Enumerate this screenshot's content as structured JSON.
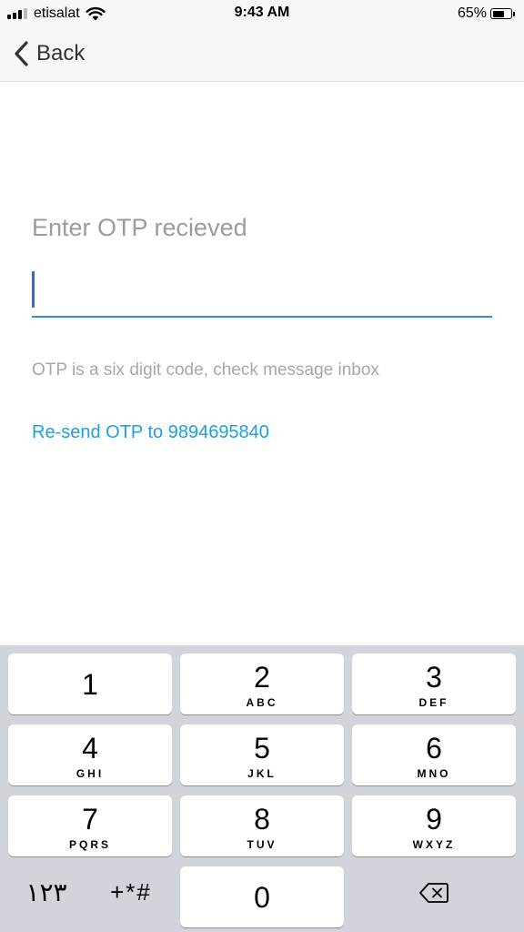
{
  "status_bar": {
    "carrier": "etisalat",
    "time": "9:43 AM",
    "battery_percent": "65%",
    "battery_level": 0.65,
    "signal_bars": 3,
    "signal_bars_total": 4,
    "icons": [
      "signal-icon",
      "wifi-icon",
      "battery-icon"
    ]
  },
  "nav": {
    "back_label": "Back",
    "back_icon": "chevron-left-icon"
  },
  "otp": {
    "title": "Enter OTP recieved",
    "input_value": "",
    "hint": "OTP is a six digit code, check message inbox",
    "resend_label": "Re-send OTP to 9894695840"
  },
  "keypad": {
    "keys": [
      {
        "digit": "1",
        "letters": ""
      },
      {
        "digit": "2",
        "letters": "ABC"
      },
      {
        "digit": "3",
        "letters": "DEF"
      },
      {
        "digit": "4",
        "letters": "GHI"
      },
      {
        "digit": "5",
        "letters": "JKL"
      },
      {
        "digit": "6",
        "letters": "MNO"
      },
      {
        "digit": "7",
        "letters": "PQRS"
      },
      {
        "digit": "8",
        "letters": "TUV"
      },
      {
        "digit": "9",
        "letters": "WXYZ"
      },
      {
        "digit": "0",
        "letters": ""
      }
    ],
    "arabic_digits_label": "١٢٣",
    "symbols_label": "+*#",
    "delete_icon": "backspace-icon"
  },
  "colors": {
    "accent": "#2f8fde",
    "link": "#1ba1de",
    "placeholder_text": "#9c9c9c",
    "keypad_background": "#d1d4da"
  }
}
